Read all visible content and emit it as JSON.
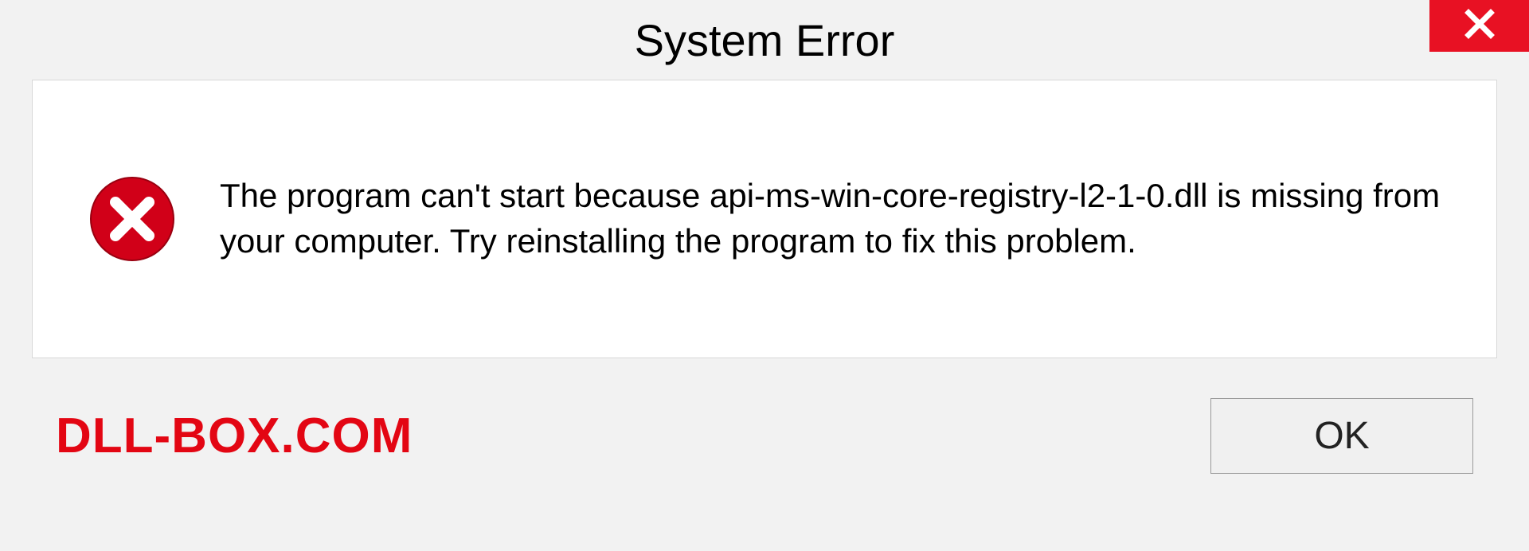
{
  "titlebar": {
    "title": "System Error",
    "close_icon": "close-icon"
  },
  "body": {
    "error_icon": "error-circle-x-icon",
    "message": "The program can't start because api-ms-win-core-registry-l2-1-0.dll is missing from your computer. Try reinstalling the program to fix this problem."
  },
  "footer": {
    "watermark": "DLL-BOX.COM",
    "ok_label": "OK"
  },
  "colors": {
    "close_bg": "#e81123",
    "error_icon": "#d10018",
    "watermark": "#e30613"
  }
}
